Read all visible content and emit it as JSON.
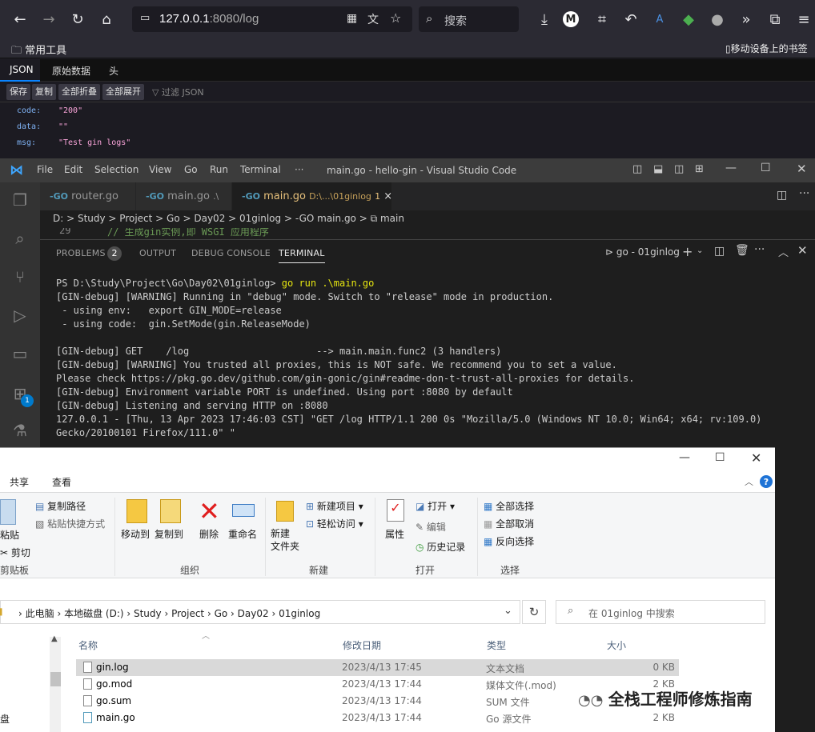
{
  "browser": {
    "url_host": "127.0.0.1",
    "url_path": ":8080/log",
    "search_placeholder": "搜索",
    "bookmarks": {
      "left": "常用工具",
      "right": "移动设备上的书签"
    },
    "json_tabs": [
      "JSON",
      "原始数据",
      "头"
    ],
    "json_tools": [
      "保存",
      "复制",
      "全部折叠",
      "全部展开"
    ],
    "filter_placeholder": "过滤 JSON",
    "json_rows": [
      {
        "key": "code:",
        "value": "\"200\""
      },
      {
        "key": "data:",
        "value": "\"\""
      },
      {
        "key": "msg:",
        "value": "\"Test gin logs\""
      }
    ]
  },
  "vscode": {
    "menu": [
      "File",
      "Edit",
      "Selection",
      "View",
      "Go",
      "Run",
      "Terminal",
      "···"
    ],
    "title": "main.go - hello-gin - Visual Studio Code",
    "tabs": [
      {
        "icon": "-GO",
        "label": "router.go",
        "detail": ""
      },
      {
        "icon": "-GO",
        "label": "main.go",
        "detail": ".\\"
      },
      {
        "icon": "-GO",
        "label": "main.go",
        "detail": "D:\\...\\01ginlog",
        "count": "1",
        "close": "×"
      }
    ],
    "breadcrumb": "D: > Study > Project > Go > Day02 > 01ginlog > -GO main.go > ⧉ main",
    "code_line_number": "29",
    "code_line_text": "// 生成gin实例,即 WSGI 应用程序",
    "panel_tabs": [
      "PROBLEMS",
      "OUTPUT",
      "DEBUG CONSOLE",
      "TERMINAL"
    ],
    "problems_count": "2",
    "terminal_name": "go - 01ginlog",
    "activity_badge": "1",
    "terminal": {
      "prompt": "PS D:\\Study\\Project\\Go\\Day02\\01ginlog> ",
      "command": "go run .\\main.go",
      "output": "[GIN-debug] [WARNING] Running in \"debug\" mode. Switch to \"release\" mode in production.\n - using env:   export GIN_MODE=release\n - using code:  gin.SetMode(gin.ReleaseMode)\n\n[GIN-debug] GET    /log                      --> main.main.func2 (3 handlers)\n[GIN-debug] [WARNING] You trusted all proxies, this is NOT safe. We recommend you to set a value.\nPlease check https://pkg.go.dev/github.com/gin-gonic/gin#readme-don-t-trust-all-proxies for details.\n[GIN-debug] Environment variable PORT is undefined. Using port :8080 by default\n[GIN-debug] Listening and serving HTTP on :8080\n127.0.0.1 - [Thu, 13 Apr 2023 17:46:03 CST] \"GET /log HTTP/1.1 200 0s \"Mozilla/5.0 (Windows NT 10.0; Win64; x64; rv:109.0) Gecko/20100101 Firefox/111.0\" \""
    }
  },
  "explorer": {
    "menu_tabs": [
      "共享",
      "查看"
    ],
    "ribbon": {
      "copy_path": "复制路径",
      "paste_shortcut": "粘贴快捷方式",
      "paste": "粘贴",
      "cut": "剪切",
      "clipboard": "剪贴板",
      "move_to": "移动到",
      "copy_to": "复制到",
      "delete": "删除",
      "rename": "重命名",
      "organize": "组织",
      "new_folder": "新建\n文件夹",
      "new_item": "新建项目 ▾",
      "easy_access": "轻松访问 ▾",
      "new": "新建",
      "properties": "属性",
      "open": "打开 ▾",
      "edit": "编辑",
      "history": "历史记录",
      "open_group": "打开",
      "select_all": "全部选择",
      "select_none": "全部取消",
      "invert": "反向选择",
      "select_group": "选择"
    },
    "path": [
      "此电脑",
      "本地磁盘 (D:)",
      "Study",
      "Project",
      "Go",
      "Day02",
      "01ginlog"
    ],
    "search_placeholder": "在 01ginlog 中搜索",
    "columns": [
      "名称",
      "修改日期",
      "类型",
      "大小"
    ],
    "left_label": "盘",
    "files": [
      {
        "name": "gin.log",
        "date": "2023/4/13 17:45",
        "type": "文本文档",
        "size": "0 KB"
      },
      {
        "name": "go.mod",
        "date": "2023/4/13 17:44",
        "type": "媒体文件(.mod)",
        "size": "2 KB"
      },
      {
        "name": "go.sum",
        "date": "2023/4/13 17:44",
        "type": "SUM 文件",
        "size": ""
      },
      {
        "name": "main.go",
        "date": "2023/4/13 17:44",
        "type": "Go 源文件",
        "size": "2 KB"
      }
    ]
  },
  "watermark": "全栈工程师修炼指南"
}
